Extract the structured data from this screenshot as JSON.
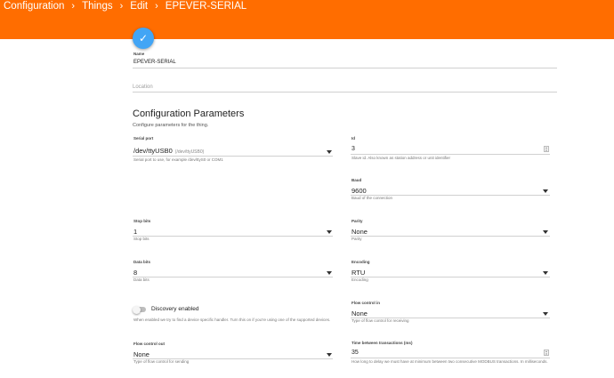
{
  "header": {
    "breadcrumb": [
      "Configuration",
      "Things",
      "Edit",
      "EPEVER-SERIAL"
    ],
    "separator": "›"
  },
  "save_button": {
    "icon": "check-icon",
    "glyph": "✓"
  },
  "name_field": {
    "label": "Name",
    "value": "EPEVER-SERIAL"
  },
  "location_field": {
    "placeholder": "Location"
  },
  "config": {
    "title": "Configuration Parameters",
    "subtitle": "Configure parameters for the thing.",
    "serial_port": {
      "label": "Serial port",
      "value": "/dev/ttyUSB0",
      "sub": "(/dev/ttyUSB0)",
      "help": "Serial port to use, for example /dev/ttyS0 or COM1"
    },
    "id": {
      "label": "Id",
      "value": "3",
      "help": "Slave id. Also known as station address or unit identifier"
    },
    "baud": {
      "label": "Baud",
      "value": "9600",
      "help": "Baud of the connection"
    },
    "stop_bits": {
      "label": "Stop bits",
      "value": "1",
      "help": "Stop bits"
    },
    "parity": {
      "label": "Parity",
      "value": "None",
      "help": "Parity"
    },
    "data_bits": {
      "label": "Data bits",
      "value": "8",
      "help": "Data bits"
    },
    "encoding": {
      "label": "Encoding",
      "value": "RTU",
      "help": "Encoding"
    },
    "discovery": {
      "label": "Discovery enabled",
      "enabled": false,
      "help": "When enabled we try to find a device specific handler. Turn this on if you're using one of the supported devices."
    },
    "flow_control_in": {
      "label": "Flow control in",
      "value": "None",
      "help": "Type of flow control for receiving"
    },
    "flow_control_out": {
      "label": "Flow control out",
      "value": "None",
      "help": "Type of flow control for sending"
    },
    "time_between": {
      "label": "Time between transactions (ms)",
      "value": "35",
      "help": "How long to delay we must have at minimum between two consecutive MODBUS transactions. In milliseconds."
    }
  },
  "colors": {
    "header": "#ff6d00",
    "fab": "#42a5f5"
  }
}
